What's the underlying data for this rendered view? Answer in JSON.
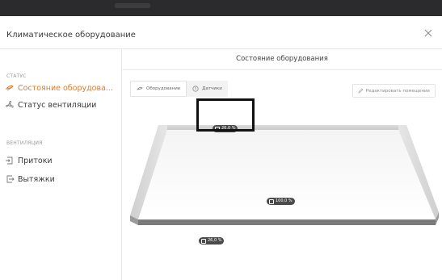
{
  "dialog": {
    "title": "Климатическое оборудование",
    "close_icon": "close-icon"
  },
  "sidebar": {
    "status_label": "СТАТУС",
    "ventilation_label": "ВЕНТИЛЯЦИЯ",
    "items": [
      {
        "label": "Состояние оборудова...",
        "icon": "fan-icon",
        "active": true
      },
      {
        "label": "Статус вентиляции",
        "icon": "fan-outline-icon",
        "active": false
      },
      {
        "label": "Притоки",
        "icon": "inflow-icon",
        "active": false
      },
      {
        "label": "Вытяжки",
        "icon": "exhaust-icon",
        "active": false
      }
    ]
  },
  "main": {
    "title": "Состояние оборудования",
    "tabs": [
      {
        "label": "Оборудование",
        "icon": "fan-icon",
        "active": true
      },
      {
        "label": "Датчики",
        "icon": "sensor-icon",
        "active": false
      }
    ],
    "edit_button": "Редактировать помещение"
  },
  "scene": {
    "badges": [
      {
        "value": "26,0 %",
        "icon": "inflow-icon"
      },
      {
        "value": "100,0 %",
        "icon": "exhaust-icon"
      },
      {
        "value": "26,0 %",
        "icon": "inflow-icon"
      }
    ]
  },
  "colors": {
    "accent": "#e07b2a",
    "background_dark": "#2f2f31",
    "badge": "#4a4a4a"
  }
}
